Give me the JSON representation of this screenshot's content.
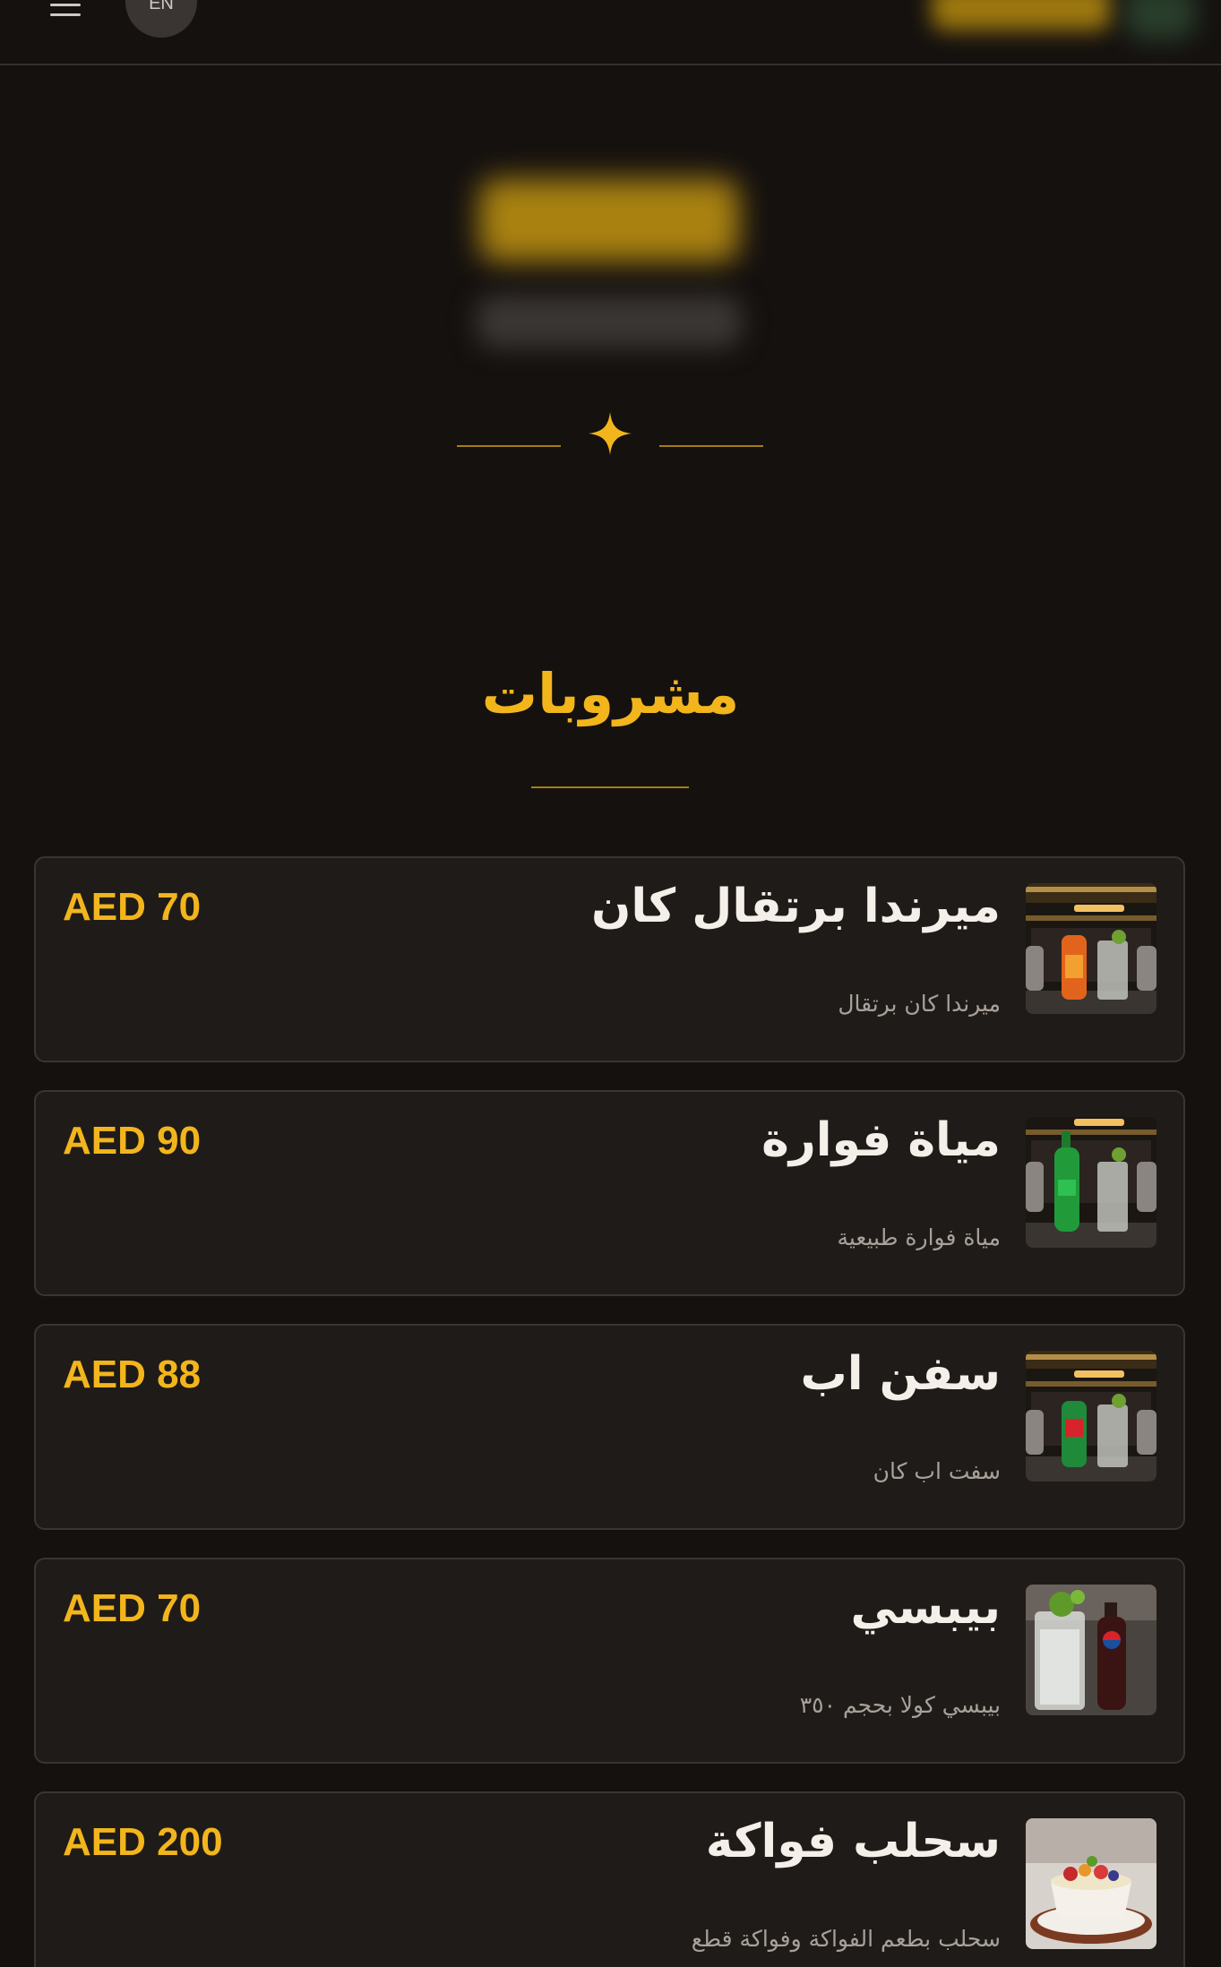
{
  "header": {
    "menu_icon": "hamburger-menu-icon",
    "language_label": "EN"
  },
  "section": {
    "title": "مشروبات"
  },
  "items": [
    {
      "name": "ميرندا برتقال كان",
      "description": "ميرندا كان برتقال",
      "price": "AED 70",
      "image": "orange-soda-can-with-glass"
    },
    {
      "name": "مياة فوارة",
      "description": "مياة فوارة طبيعية",
      "price": "AED 90",
      "image": "green-sparkling-water-bottle-with-glass"
    },
    {
      "name": "سفن اب",
      "description": "سفت اب كان",
      "price": "AED 88",
      "image": "7up-can-with-glass"
    },
    {
      "name": "بيبسي",
      "description": "بيبسي كولا بحجم ٣٥٠",
      "price": "AED 70",
      "image": "pepsi-bottle-with-glass"
    },
    {
      "name": "سحلب فواكة",
      "description": "سحلب بطعم الفواكة وفواكة قطع",
      "price": "AED 200",
      "image": "sahlab-with-fruit-cup"
    }
  ],
  "colors": {
    "background": "#15110f",
    "card": "#1f1b18",
    "accent": "#f2b51c"
  }
}
